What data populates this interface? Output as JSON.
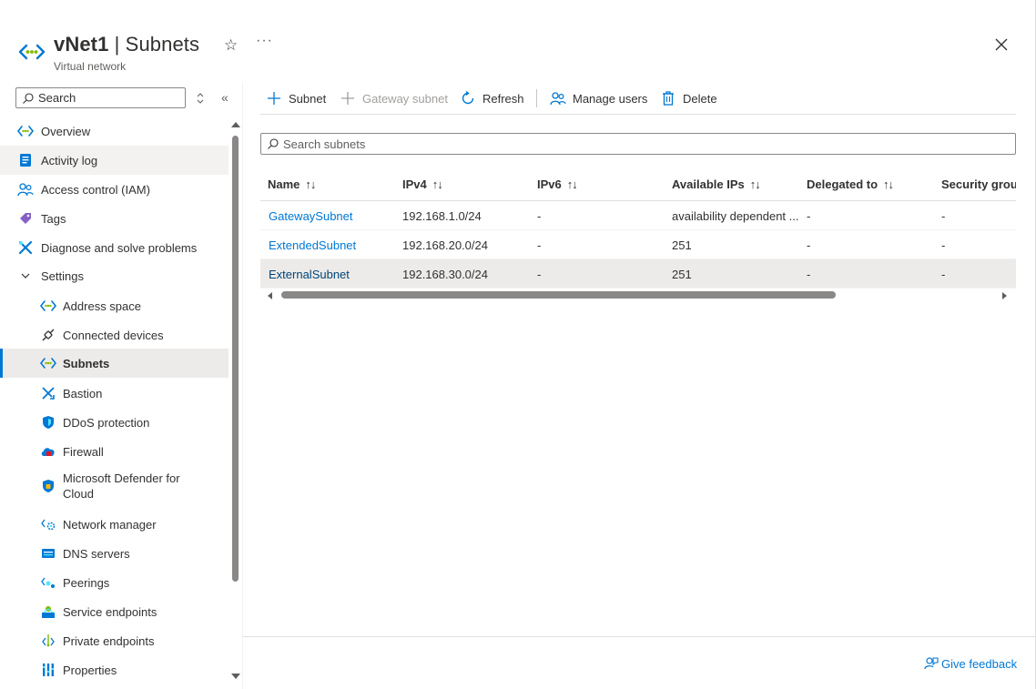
{
  "header": {
    "resource_name": "vNet1",
    "separator": " | ",
    "page_name": "Subnets",
    "subtitle": "Virtual network",
    "favorite_glyph": "☆",
    "more_glyph": "···"
  },
  "sidebar": {
    "search_placeholder": "Search",
    "collapse_glyph": "«",
    "items": [
      {
        "label": "Overview",
        "icon": "vnet-icon"
      },
      {
        "label": "Activity log",
        "icon": "activity-log-icon"
      },
      {
        "label": "Access control (IAM)",
        "icon": "iam-icon"
      },
      {
        "label": "Tags",
        "icon": "tag-icon"
      },
      {
        "label": "Diagnose and solve problems",
        "icon": "wrench-icon"
      },
      {
        "label": "Settings",
        "icon": "chevron-down-icon"
      },
      {
        "label": "Address space",
        "icon": "vnet-icon"
      },
      {
        "label": "Connected devices",
        "icon": "plug-icon"
      },
      {
        "label": "Subnets",
        "icon": "vnet-icon"
      },
      {
        "label": "Bastion",
        "icon": "bastion-icon"
      },
      {
        "label": "DDoS protection",
        "icon": "shield-icon"
      },
      {
        "label": "Firewall",
        "icon": "firewall-icon"
      },
      {
        "label": "Microsoft Defender for Cloud",
        "icon": "defender-shield-icon"
      },
      {
        "label": "Network manager",
        "icon": "network-manager-icon"
      },
      {
        "label": "DNS servers",
        "icon": "dns-icon"
      },
      {
        "label": "Peerings",
        "icon": "peering-icon"
      },
      {
        "label": "Service endpoints",
        "icon": "service-endpoint-icon"
      },
      {
        "label": "Private endpoints",
        "icon": "private-endpoint-icon"
      },
      {
        "label": "Properties",
        "icon": "properties-icon"
      }
    ]
  },
  "toolbar": {
    "add_subnet": "Subnet",
    "add_gateway_subnet": "Gateway subnet",
    "refresh": "Refresh",
    "manage_users": "Manage users",
    "delete": "Delete"
  },
  "subnet_search": {
    "placeholder": "Search subnets"
  },
  "table": {
    "sort_glyph": "↑↓",
    "columns": [
      "Name",
      "IPv4",
      "IPv6",
      "Available IPs",
      "Delegated to",
      "Security group"
    ],
    "rows": [
      [
        "GatewaySubnet",
        "192.168.1.0/24",
        "-",
        "availability dependent ...",
        "-",
        "-"
      ],
      [
        "ExtendedSubnet",
        "192.168.20.0/24",
        "-",
        "251",
        "-",
        "-"
      ],
      [
        "ExternalSubnet",
        "192.168.30.0/24",
        "-",
        "251",
        "-",
        "-"
      ]
    ]
  },
  "footer": {
    "feedback": "Give feedback"
  },
  "colors": {
    "accent": "#0078d4",
    "selected_bg": "#edebe9"
  }
}
